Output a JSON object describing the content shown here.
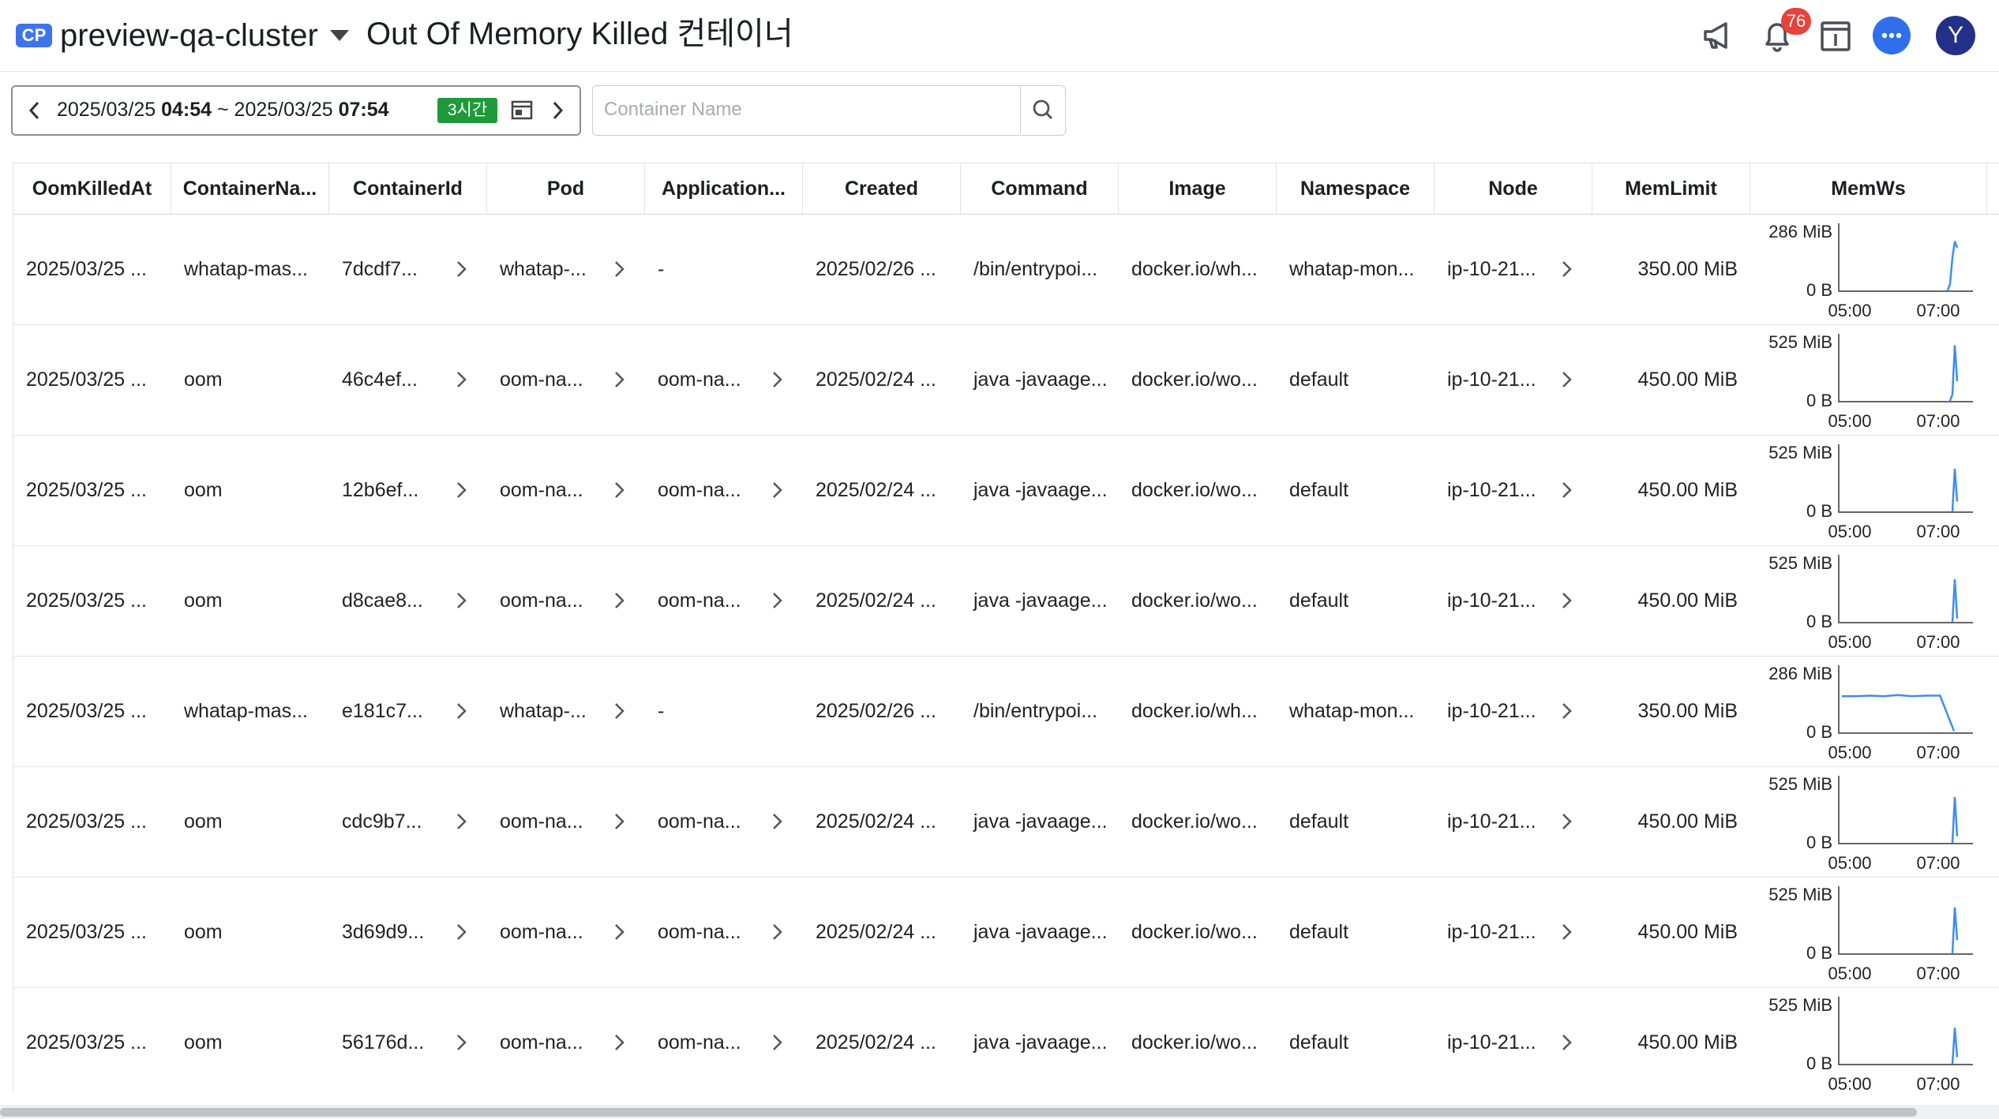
{
  "header": {
    "cluster_badge": "CP",
    "cluster_name": "preview-qa-cluster",
    "page_title": "Out Of Memory Killed 컨테이너",
    "notification_count": "76",
    "avatar_letter": "Y"
  },
  "toolbar": {
    "date_start": "2025/03/25",
    "time_start": "04:54",
    "separator": "~",
    "date_end": "2025/03/25",
    "time_end": "07:54",
    "range_label": "3시간",
    "search_placeholder": "Container Name",
    "search_value": ""
  },
  "table": {
    "columns": [
      "OomKilledAt",
      "ContainerNa...",
      "ContainerId",
      "Pod",
      "Application...",
      "Created",
      "Command",
      "Image",
      "Namespace",
      "Node",
      "MemLimit",
      "MemWs"
    ],
    "rows": [
      {
        "oom_killed_at": "2025/03/25 ...",
        "container_name": "whatap-mas...",
        "container_id": "7dcdf7...",
        "pod": "whatap-...",
        "application": "-",
        "created": "2025/02/26 ...",
        "command": "/bin/entrypoi...",
        "image": "docker.io/wh...",
        "namespace": "whatap-mon...",
        "node": "ip-10-21...",
        "mem_limit": "350.00 MiB",
        "memws": {
          "y_max": "286 MiB",
          "y_min": "0 B",
          "x_ticks": [
            "05:00",
            "07:00"
          ],
          "spike_series": [
            0,
            0.1,
            0.5,
            0.75,
            0.65
          ]
        }
      },
      {
        "oom_killed_at": "2025/03/25 ...",
        "container_name": "oom",
        "container_id": "46c4ef...",
        "pod": "oom-na...",
        "application": "oom-na...",
        "created": "2025/02/24 ...",
        "command": "java -javaage...",
        "image": "docker.io/wo...",
        "namespace": "default",
        "node": "ip-10-21...",
        "mem_limit": "450.00 MiB",
        "memws": {
          "y_max": "525 MiB",
          "y_min": "0 B",
          "x_ticks": [
            "05:00",
            "07:00"
          ],
          "spike_series": [
            0,
            0.1,
            0.85,
            0.3
          ]
        }
      },
      {
        "oom_killed_at": "2025/03/25 ...",
        "container_name": "oom",
        "container_id": "12b6ef...",
        "pod": "oom-na...",
        "application": "oom-na...",
        "created": "2025/02/24 ...",
        "command": "java -javaage...",
        "image": "docker.io/wo...",
        "namespace": "default",
        "node": "ip-10-21...",
        "mem_limit": "450.00 MiB",
        "memws": {
          "y_max": "525 MiB",
          "y_min": "0 B",
          "x_ticks": [
            "05:00",
            "07:00"
          ],
          "spike_series": [
            0,
            0.65,
            0.15
          ]
        }
      },
      {
        "oom_killed_at": "2025/03/25 ...",
        "container_name": "oom",
        "container_id": "d8cae8...",
        "pod": "oom-na...",
        "application": "oom-na...",
        "created": "2025/02/24 ...",
        "command": "java -javaage...",
        "image": "docker.io/wo...",
        "namespace": "default",
        "node": "ip-10-21...",
        "mem_limit": "450.00 MiB",
        "memws": {
          "y_max": "525 MiB",
          "y_min": "0 B",
          "x_ticks": [
            "05:00",
            "07:00"
          ],
          "spike_series": [
            0,
            0.65,
            0.05
          ]
        }
      },
      {
        "oom_killed_at": "2025/03/25 ...",
        "container_name": "whatap-mas...",
        "container_id": "e181c7...",
        "pod": "whatap-...",
        "application": "-",
        "created": "2025/02/26 ...",
        "command": "/bin/entrypoi...",
        "image": "docker.io/wh...",
        "namespace": "whatap-mon...",
        "node": "ip-10-21...",
        "mem_limit": "350.00 MiB",
        "memws": {
          "y_max": "286 MiB",
          "y_min": "0 B",
          "x_ticks": [
            "05:00",
            "07:00"
          ],
          "spike_series": [
            0.55,
            0.55,
            0.56,
            0.55,
            0.57,
            0.55,
            0.56,
            0.56,
            0.02
          ]
        }
      },
      {
        "oom_killed_at": "2025/03/25 ...",
        "container_name": "oom",
        "container_id": "cdc9b7...",
        "pod": "oom-na...",
        "application": "oom-na...",
        "created": "2025/02/24 ...",
        "command": "java -javaage...",
        "image": "docker.io/wo...",
        "namespace": "default",
        "node": "ip-10-21...",
        "mem_limit": "450.00 MiB",
        "memws": {
          "y_max": "525 MiB",
          "y_min": "0 B",
          "x_ticks": [
            "05:00",
            "07:00"
          ],
          "spike_series": [
            0,
            0.7,
            0.1
          ]
        }
      },
      {
        "oom_killed_at": "2025/03/25 ...",
        "container_name": "oom",
        "container_id": "3d69d9...",
        "pod": "oom-na...",
        "application": "oom-na...",
        "created": "2025/02/24 ...",
        "command": "java -javaage...",
        "image": "docker.io/wo...",
        "namespace": "default",
        "node": "ip-10-21...",
        "mem_limit": "450.00 MiB",
        "memws": {
          "y_max": "525 MiB",
          "y_min": "0 B",
          "x_ticks": [
            "05:00",
            "07:00"
          ],
          "spike_series": [
            0,
            0.7,
            0.2
          ]
        }
      },
      {
        "oom_killed_at": "2025/03/25 ...",
        "container_name": "oom",
        "container_id": "56176d...",
        "pod": "oom-na...",
        "application": "oom-na...",
        "created": "2025/02/24 ...",
        "command": "java -javaage...",
        "image": "docker.io/wo...",
        "namespace": "default",
        "node": "ip-10-21...",
        "mem_limit": "450.00 MiB",
        "memws": {
          "y_max": "525 MiB",
          "y_min": "0 B",
          "x_ticks": [
            "05:00",
            "07:00"
          ],
          "spike_series": [
            0,
            0.55,
            0.1
          ]
        }
      }
    ]
  },
  "colors": {
    "accent": "#3d74ee",
    "range_chip": "#1f9a3a",
    "notification": "#e9413b",
    "avatar": "#22308a",
    "sparkline": "#3d8ef0"
  },
  "icons": {
    "megaphone": "megaphone-icon",
    "bell": "bell-icon",
    "info_panel": "info-panel-icon",
    "chat": "chat-icon",
    "calendar": "calendar-icon",
    "search": "search-icon",
    "chevron_right": "chevron-right-icon",
    "chevron_left": "chevron-left-icon"
  }
}
